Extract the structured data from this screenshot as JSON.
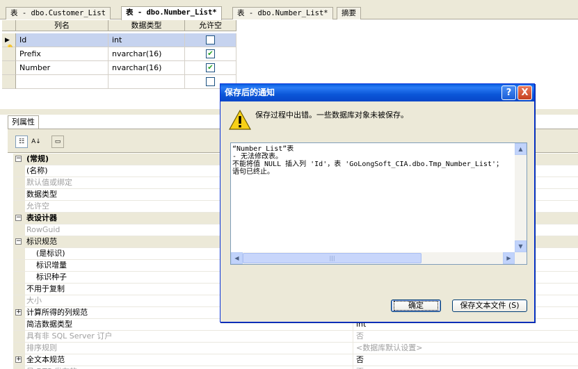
{
  "tabs": [
    {
      "label": "表 - dbo.Customer_List",
      "active": false
    },
    {
      "label": "表 - dbo.Number_List*",
      "active": true
    },
    {
      "label": "表 - dbo.Number_List*",
      "active": false
    },
    {
      "label": "摘要",
      "active": false
    }
  ],
  "grid": {
    "headers": {
      "name": "列名",
      "type": "数据类型",
      "nullable": "允许空"
    },
    "rows": [
      {
        "name": "Id",
        "type": "int",
        "nullable": false,
        "primary_key": true
      },
      {
        "name": "Prefix",
        "type": "nvarchar(16)",
        "nullable": true
      },
      {
        "name": "Number",
        "type": "nvarchar(16)",
        "nullable": true
      },
      {
        "name": "",
        "type": "",
        "nullable": false
      }
    ]
  },
  "properties": {
    "tab_label": "列属性",
    "toolbar_icons": [
      "categorized-icon",
      "alphabetical-icon",
      "property-pages-icon"
    ],
    "rows": [
      {
        "kind": "cat",
        "name": "(常规)",
        "value": "",
        "expander": "minus"
      },
      {
        "kind": "item",
        "name": "(名称)",
        "value": "",
        "indent": 0
      },
      {
        "kind": "dim",
        "name": "默认值或绑定",
        "value": "",
        "indent": 0
      },
      {
        "kind": "item",
        "name": "数据类型",
        "value": "",
        "indent": 0
      },
      {
        "kind": "dim",
        "name": "允许空",
        "value": "",
        "indent": 0
      },
      {
        "kind": "cat",
        "name": "表设计器",
        "value": "",
        "expander": "minus"
      },
      {
        "kind": "dim",
        "name": "RowGuid",
        "value": "",
        "indent": 0
      },
      {
        "kind": "sub",
        "name": "标识规范",
        "value": "",
        "expander": "minus"
      },
      {
        "kind": "item",
        "name": "(是标识)",
        "value": "",
        "indent": 1
      },
      {
        "kind": "item",
        "name": "标识增量",
        "value": "",
        "indent": 1
      },
      {
        "kind": "item",
        "name": "标识种子",
        "value": "",
        "indent": 1
      },
      {
        "kind": "item",
        "name": "不用于复制",
        "value": "",
        "indent": 0
      },
      {
        "kind": "dim",
        "name": "大小",
        "value": "",
        "indent": 0
      },
      {
        "kind": "item",
        "name": "计算所得的列规范",
        "value": "",
        "expander": "plus"
      },
      {
        "kind": "item",
        "name": "简洁数据类型",
        "value": "int",
        "indent": 0
      },
      {
        "kind": "dim",
        "name": "具有非 SQL Server 订户",
        "value": "否",
        "indent": 0
      },
      {
        "kind": "dim",
        "name": "排序规则",
        "value": "<数据库默认设置>",
        "indent": 0
      },
      {
        "kind": "item",
        "name": "全文本规范",
        "value": "否",
        "expander": "plus"
      },
      {
        "kind": "dim",
        "name": "是 DTS 发布的",
        "value": "否",
        "indent": 0
      }
    ]
  },
  "dialog": {
    "title": "保存后的通知",
    "help_label": "?",
    "close_label": "X",
    "message": "保存过程中出错。一些数据库对象未被保存。",
    "error_text": "“Number_List”表\n- 无法修改表。\n不能将值 NULL 插入列 'Id'，表 'GoLongSoft_CIA.dbo.Tmp_Number_List'；\n语句已终止。",
    "ok_label": "确定",
    "save_label": "保存文本文件 (S)"
  }
}
